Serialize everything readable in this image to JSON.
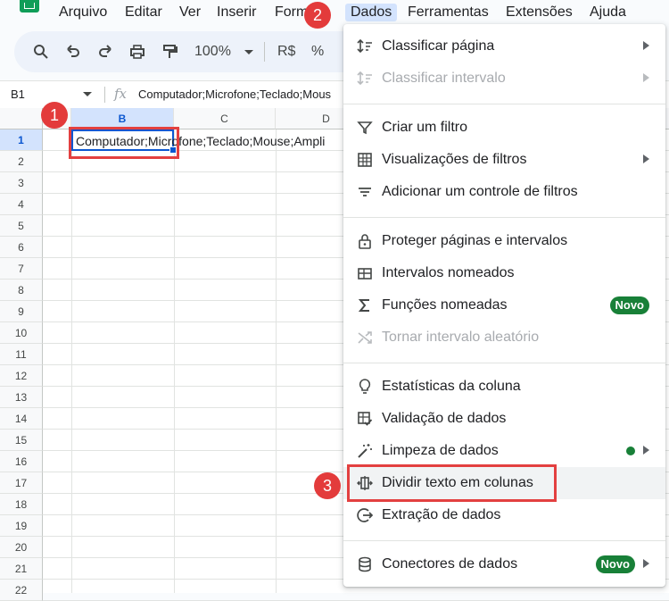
{
  "menubar": {
    "items": [
      "Arquivo",
      "Editar",
      "Ver",
      "Inserir",
      "Form",
      "Dados",
      "Ferramentas",
      "Extensões",
      "Ajuda"
    ]
  },
  "toolbar": {
    "zoom": "100%",
    "currency": "R$",
    "percent": "%"
  },
  "formula_bar": {
    "cell_ref": "B1",
    "fx": "fx",
    "content": "Computador;Microfone;Teclado;Mous"
  },
  "grid": {
    "columns": [
      "B",
      "C",
      "D"
    ],
    "rows": [
      "1",
      "2",
      "3",
      "4",
      "5",
      "6",
      "7",
      "8",
      "9",
      "10",
      "11",
      "12",
      "13",
      "14",
      "15",
      "16",
      "17",
      "18",
      "19",
      "20",
      "21",
      "22"
    ],
    "cell_b1": "Computador;Microfone;Teclado;Mouse;Ampli"
  },
  "dropdown": {
    "items": [
      {
        "label": "Classificar página",
        "icon": "sort-icon"
      },
      {
        "label": "Classificar intervalo",
        "icon": "sort-range-icon"
      },
      {
        "label": "Criar um filtro",
        "icon": "filter-icon"
      },
      {
        "label": "Visualizações de filtros",
        "icon": "filter-view-icon"
      },
      {
        "label": "Adicionar um controle de filtros",
        "icon": "slicer-icon"
      },
      {
        "label": "Proteger páginas e intervalos",
        "icon": "lock-icon"
      },
      {
        "label": "Intervalos nomeados",
        "icon": "named-range-icon"
      },
      {
        "label": "Funções nomeadas",
        "icon": "sigma-icon",
        "badge": "Novo"
      },
      {
        "label": "Tornar intervalo aleatório",
        "icon": "shuffle-icon"
      },
      {
        "label": "Estatísticas da coluna",
        "icon": "lightbulb-icon"
      },
      {
        "label": "Validação de dados",
        "icon": "validation-icon"
      },
      {
        "label": "Limpeza de dados",
        "icon": "magic-wand-icon"
      },
      {
        "label": "Dividir texto em colunas",
        "icon": "split-icon"
      },
      {
        "label": "Extração de dados",
        "icon": "extract-icon"
      },
      {
        "label": "Conectores de dados",
        "icon": "database-icon",
        "badge": "Novo"
      }
    ]
  },
  "callouts": [
    "1",
    "2",
    "3"
  ],
  "colors": {
    "accent": "#0b57d0",
    "badge": "#188038",
    "callout": "#e33b3b"
  }
}
